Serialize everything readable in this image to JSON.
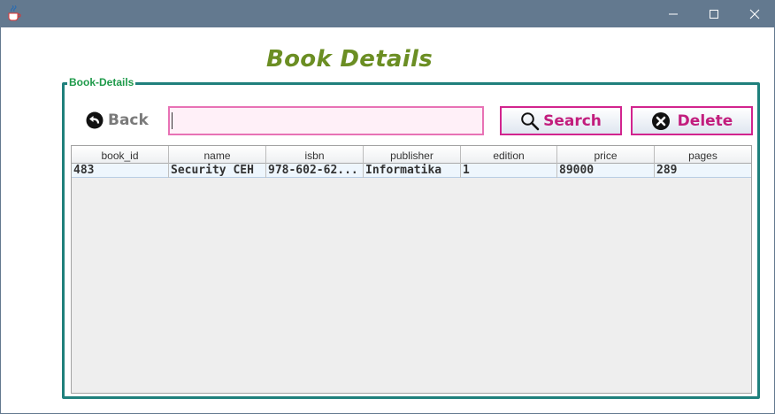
{
  "window": {
    "icon": "java-cup-icon",
    "controls": [
      "minimize-icon",
      "maximize-icon",
      "close-icon"
    ]
  },
  "page_title": "Book Details",
  "group": {
    "legend": "Book-Details"
  },
  "toolbar": {
    "back_label": "Back",
    "search_value": "",
    "search_label": "Search",
    "delete_label": "Delete"
  },
  "table": {
    "columns": [
      "book_id",
      "name",
      "isbn",
      "publisher",
      "edition",
      "price",
      "pages"
    ],
    "rows": [
      [
        "483",
        "Security CEH",
        "978-602-62...",
        "Informatika",
        "1",
        "89000",
        "289"
      ]
    ]
  },
  "colors": {
    "titlebar": "#63798f",
    "title_text": "#6b8e23",
    "group_border": "#1f807c",
    "legend_text": "#1e9a4a",
    "accent_pink": "#c21d7d",
    "input_border": "#e872b5",
    "input_bg": "#fff0f8"
  }
}
